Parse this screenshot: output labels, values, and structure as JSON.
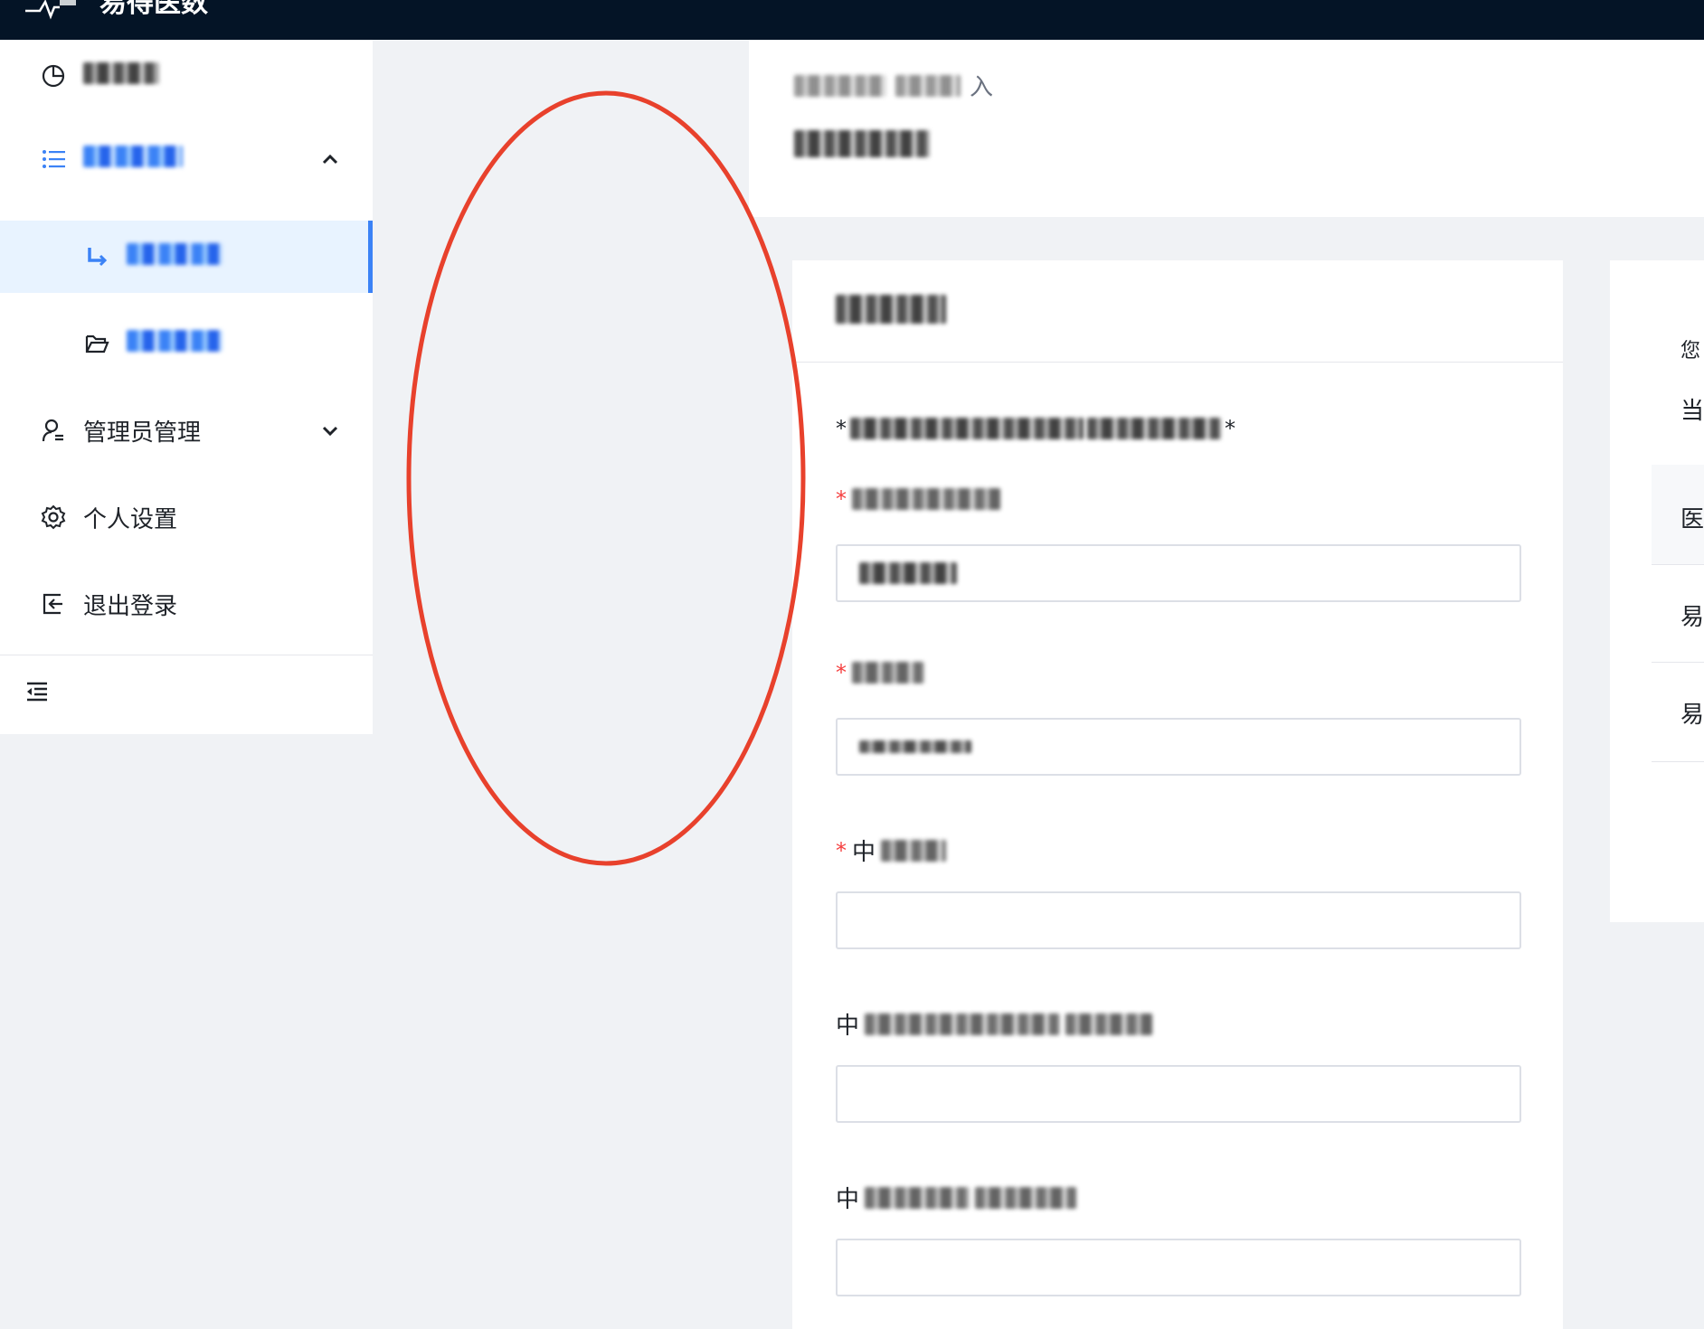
{
  "app": {
    "title": "易得医数"
  },
  "sidebar": {
    "items": [
      {
        "label": "",
        "icon": "pie-chart-icon",
        "redacted": true
      },
      {
        "label": "",
        "icon": "list-icon",
        "redacted": true,
        "expanded": true
      },
      {
        "label": "",
        "icon": "sub-arrow-icon",
        "redacted": true,
        "active": true
      },
      {
        "label": "",
        "icon": "folder-open-icon",
        "redacted": true
      },
      {
        "label": "管理员管理",
        "icon": "user-manage-icon",
        "expanded": false
      },
      {
        "label": "个人设置",
        "icon": "gear-icon"
      },
      {
        "label": "退出登录",
        "icon": "logout-icon"
      }
    ],
    "collapse_icon": "collapse-menu-icon"
  },
  "header": {
    "breadcrumb_tail": "入",
    "title_redacted": true
  },
  "form": {
    "note_prefix": "*",
    "note_suffix": "*",
    "fields": [
      {
        "required": true,
        "label_prefix": "",
        "value_redacted": true
      },
      {
        "required": true,
        "label_prefix": "",
        "value_redacted": true
      },
      {
        "required": true,
        "label_prefix": "中",
        "value": ""
      },
      {
        "required": false,
        "label_prefix": "中",
        "value": ""
      },
      {
        "required": false,
        "label_prefix": "中",
        "value": ""
      }
    ]
  },
  "right_card": {
    "rows": [
      "您",
      "当",
      "医",
      "易",
      "易"
    ]
  },
  "colors": {
    "topbar": "#041426",
    "accent": "#3b82f6",
    "active_bg": "#e8f3ff",
    "required": "#f53f3f",
    "annotation": "#e8412c"
  }
}
